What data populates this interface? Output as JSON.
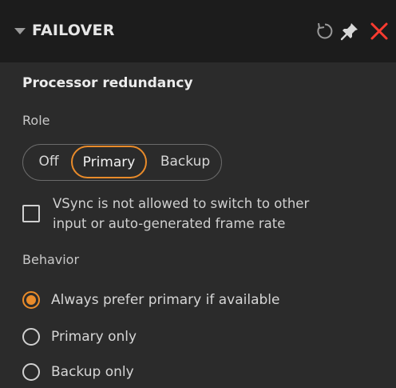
{
  "header": {
    "title": "FAILOVER",
    "icons": [
      "collapse-arrow-icon",
      "reset-icon",
      "pin-icon",
      "close-icon"
    ],
    "close_color": "#ff3b30"
  },
  "section": {
    "title": "Processor redundancy"
  },
  "role": {
    "label": "Role",
    "options": [
      "Off",
      "Primary",
      "Backup"
    ],
    "selected": "Primary",
    "accent": "#e98b2a"
  },
  "vsync": {
    "checked": false,
    "label_line1": "VSync is not allowed to switch to other",
    "label_line2": "input or auto-generated frame rate"
  },
  "behavior": {
    "label": "Behavior",
    "options": [
      {
        "label": "Always prefer primary if available",
        "selected": true
      },
      {
        "label": "Primary only",
        "selected": false
      },
      {
        "label": "Backup only",
        "selected": false
      }
    ]
  }
}
